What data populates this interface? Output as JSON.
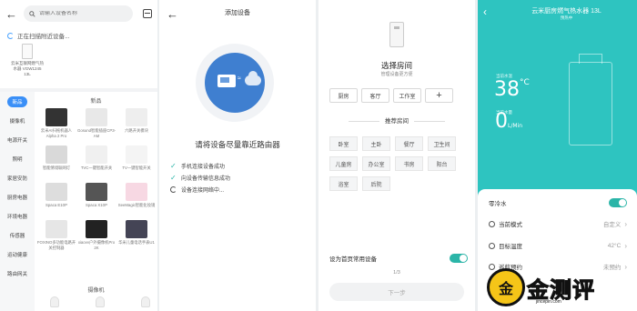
{
  "colors": {
    "accent": "#3a8ff7",
    "teal": "#2bb5a8",
    "heater_bg": "#2ec4c0"
  },
  "panel1": {
    "search_placeholder": "请输入设备名称",
    "scanning_text": "正在扫描附近设备...",
    "found_device": "云米互联网燃气热水器 VGW1245 13L",
    "section_new": "新品",
    "sidebar": [
      "新品",
      "摄像机",
      "电源开关",
      "照明",
      "家居安防",
      "厨房电器",
      "环境电器",
      "传感器",
      "运动健康",
      "路由网关"
    ],
    "products": [
      {
        "name": "云米AI扫拖机器人Alpha 2 Pro",
        "color": "#333"
      },
      {
        "name": "Gosund智能插座CP3-AM",
        "color": "#e8e8e8"
      },
      {
        "name": "六路开关模块",
        "color": "#eee"
      },
      {
        "name": "智能情境联网灯",
        "color": "#d9d9d9"
      },
      {
        "name": "TVC一键智能开关",
        "color": "#f0f0f0"
      },
      {
        "name": "TV一键智能开关",
        "color": "#f4f4f4"
      },
      {
        "name": "Spaca E10P",
        "color": "#ddd"
      },
      {
        "name": "Spaca X10P",
        "color": "#555"
      },
      {
        "name": "SeeMagic智能化妆镜",
        "color": "#f7d8e3"
      },
      {
        "name": "FOXINO多功能电路开关控制器",
        "color": "#e6e6e6"
      },
      {
        "name": "xiaovv户外摄像机Pro 2K",
        "color": "#222"
      },
      {
        "name": "华米儿童电话手表U1",
        "color": "#445"
      }
    ],
    "section_camera": "摄像机"
  },
  "panel2": {
    "title": "添加设备",
    "hint": "请将设备尽量靠近路由器",
    "steps": [
      {
        "label": "手机连接设备成功",
        "done": true
      },
      {
        "label": "向设备传输信息成功",
        "done": true
      },
      {
        "label": "设备连接网络中...",
        "done": false
      }
    ]
  },
  "panel3": {
    "title": "选择房间",
    "subtitle": "管理设备更方便",
    "rooms": [
      "厨房",
      "客厅",
      "工作室"
    ],
    "add_symbol": "+",
    "rec_title": "推荐房间",
    "rec_rooms": [
      "卧室",
      "主卧",
      "餐厅",
      "卫生间",
      "儿童房",
      "办公室",
      "书房",
      "阳台",
      "浴室",
      "后院"
    ],
    "set_home": "设为首页常用设备",
    "page_indicator": "1/3",
    "next_label": "下一步"
  },
  "panel4": {
    "title": "云米厨房燃气热水器 13L",
    "status": "预热中",
    "current_temp_label": "当前水温",
    "current_temp": "38",
    "temp_unit": "°C",
    "flow_label": "当前水量",
    "flow": "0",
    "flow_unit": "L/Min",
    "rows": [
      {
        "label": "零冷水",
        "value": "",
        "toggle": true
      },
      {
        "label": "当前模式",
        "value": "自定义",
        "toggle": false
      },
      {
        "label": "目标温度",
        "value": "42°C",
        "toggle": false
      },
      {
        "label": "巡航预约",
        "value": "未预约",
        "toggle": false
      }
    ]
  },
  "watermark": {
    "seal": "金",
    "text": "金测评",
    "url": "jincepin.com"
  }
}
